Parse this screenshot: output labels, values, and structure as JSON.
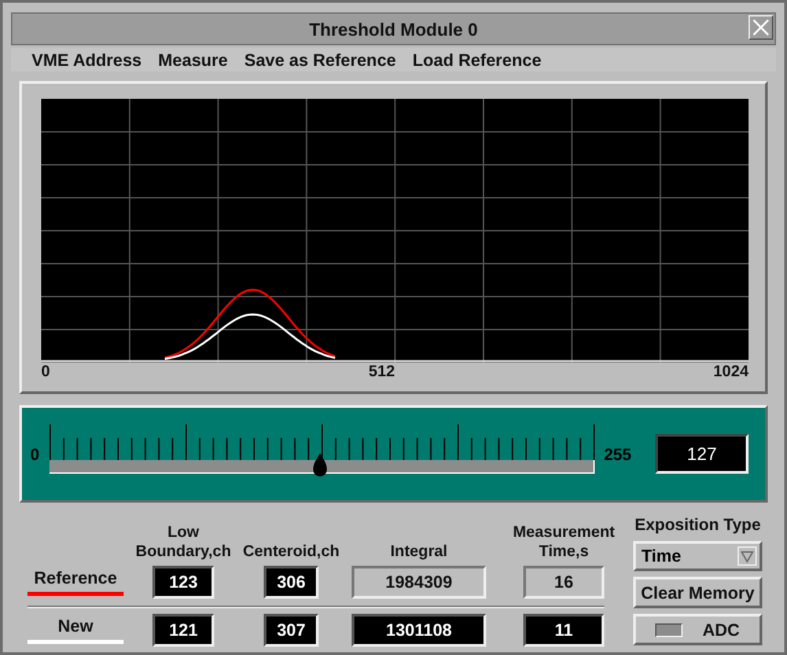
{
  "window": {
    "title": "Threshold Module 0"
  },
  "menu": [
    "VME Address",
    "Measure",
    "Save as Reference",
    "Load Reference"
  ],
  "plot": {
    "x_labels": [
      "0",
      "512",
      "1024"
    ]
  },
  "threshold_slider": {
    "min_label": "0",
    "max_label": "255",
    "level": 0.498,
    "value": "127"
  },
  "table": {
    "columns": [
      "Low\nBoundary,ch",
      "Centeroid,ch",
      "Integral",
      "Measurement\nTime,s"
    ],
    "rows": [
      {
        "label": "Reference",
        "color": "#ff0000",
        "cells": [
          {
            "value": "123",
            "disabled": false
          },
          {
            "value": "306",
            "disabled": false
          },
          {
            "value": "1984309",
            "disabled": true
          },
          {
            "value": "16",
            "disabled": true
          }
        ]
      },
      {
        "label": "New",
        "color": "#ffffff",
        "cells": [
          {
            "value": "121",
            "disabled": false
          },
          {
            "value": "307",
            "disabled": false
          },
          {
            "value": "1301108",
            "disabled": false
          },
          {
            "value": "11",
            "disabled": false
          }
        ]
      }
    ]
  },
  "exposition": {
    "label": "Exposition Type",
    "value": "Time"
  },
  "clear_button": "Clear Memory",
  "adc": {
    "label": "ADC",
    "on": false
  }
}
